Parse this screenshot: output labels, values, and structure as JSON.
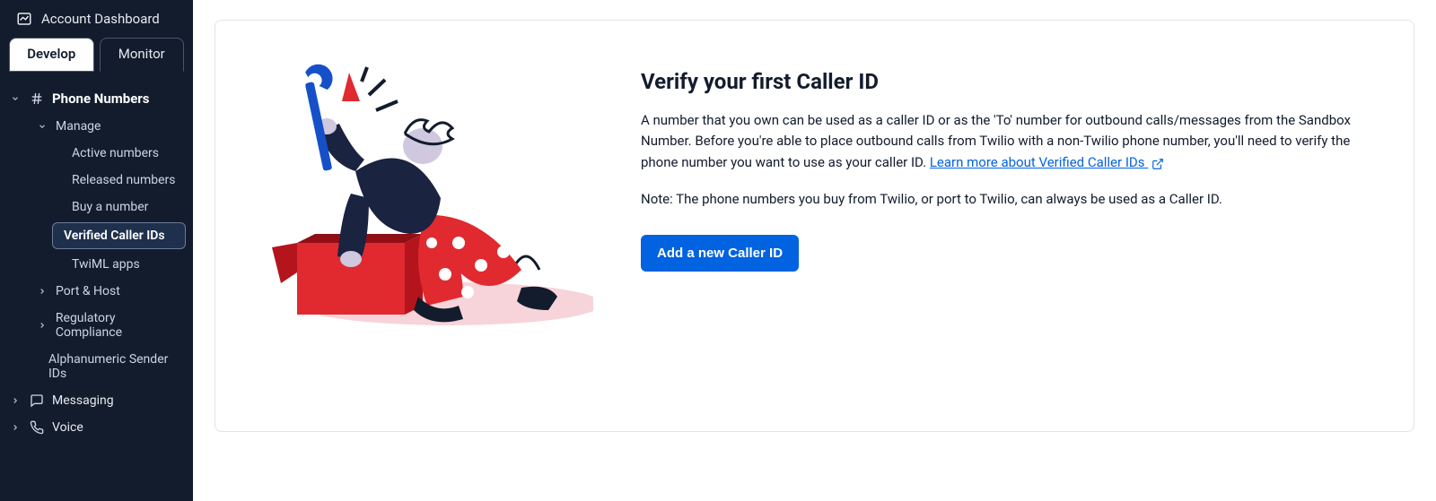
{
  "sidebar": {
    "header": "Account Dashboard",
    "tabs": {
      "develop": "Develop",
      "monitor": "Monitor"
    },
    "section_phone_numbers": "Phone Numbers",
    "manage": "Manage",
    "active_numbers": "Active numbers",
    "released_numbers": "Released numbers",
    "buy_a_number": "Buy a number",
    "verified_caller_ids": "Verified Caller IDs",
    "twiml_apps": "TwiML apps",
    "port_host": "Port & Host",
    "regulatory_compliance": "Regulatory Compliance",
    "alphanumeric_sender_ids": "Alphanumeric Sender IDs",
    "messaging": "Messaging",
    "voice": "Voice"
  },
  "content": {
    "heading": "Verify your first Caller ID",
    "para1_a": "A number that you own can be used as a caller ID or as the 'To' number for outbound calls/messages from the Sandbox Number. Before you're able to place outbound calls from Twilio with a non-Twilio phone number, you'll need to verify the phone number you want to use as your caller ID. ",
    "link_text": "Learn more about Verified Caller IDs",
    "para2": "Note: The phone numbers you buy from Twilio, or port to Twilio, can always be used as a Caller ID.",
    "cta_label": "Add a new Caller ID"
  }
}
